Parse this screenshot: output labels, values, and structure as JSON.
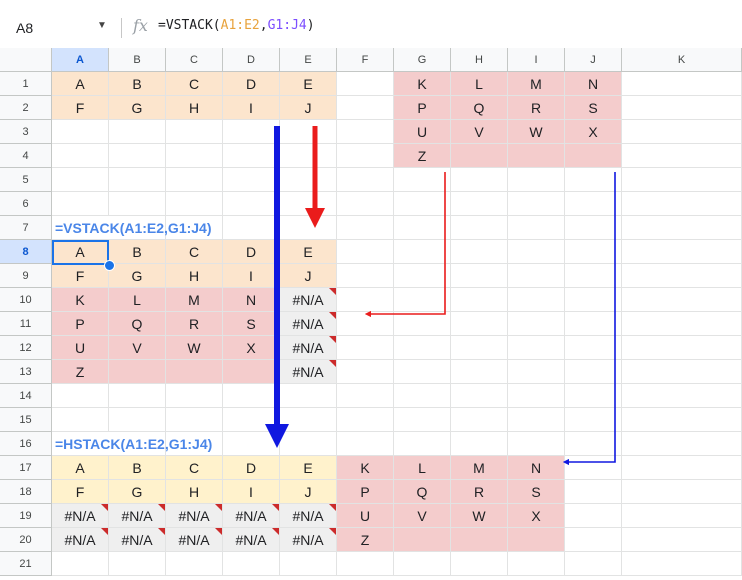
{
  "name_box": {
    "value": "A8"
  },
  "formula_bar": {
    "fx_label": "fx",
    "formula": "=VSTACK(A1:E2,G1:J4)"
  },
  "columns": [
    "A",
    "B",
    "C",
    "D",
    "E",
    "F",
    "G",
    "H",
    "I",
    "J",
    "K"
  ],
  "rows": [
    "1",
    "2",
    "3",
    "4",
    "5",
    "6",
    "7",
    "8",
    "9",
    "10",
    "11",
    "12",
    "13",
    "14",
    "15",
    "16",
    "17",
    "18",
    "19",
    "20",
    "21"
  ],
  "selected": {
    "col": "A",
    "row": "8"
  },
  "colors": {
    "orange": "#fce5cd",
    "red": "#f4cccc",
    "yellow": "#fff2cc",
    "gray": "#efefef",
    "heading": "#4a86e8",
    "arrow_red": "#ea1c1c",
    "arrow_blue": "#1018e0",
    "selection": "#1a73e8"
  },
  "cells": [
    {
      "ref": "A1",
      "value": "A",
      "fill": "orange"
    },
    {
      "ref": "B1",
      "value": "B",
      "fill": "orange"
    },
    {
      "ref": "C1",
      "value": "C",
      "fill": "orange"
    },
    {
      "ref": "D1",
      "value": "D",
      "fill": "orange"
    },
    {
      "ref": "E1",
      "value": "E",
      "fill": "orange"
    },
    {
      "ref": "A2",
      "value": "F",
      "fill": "orange"
    },
    {
      "ref": "B2",
      "value": "G",
      "fill": "orange"
    },
    {
      "ref": "C2",
      "value": "H",
      "fill": "orange"
    },
    {
      "ref": "D2",
      "value": "I",
      "fill": "orange"
    },
    {
      "ref": "E2",
      "value": "J",
      "fill": "orange"
    },
    {
      "ref": "G1",
      "value": "K",
      "fill": "red"
    },
    {
      "ref": "H1",
      "value": "L",
      "fill": "red"
    },
    {
      "ref": "I1",
      "value": "M",
      "fill": "red"
    },
    {
      "ref": "J1",
      "value": "N",
      "fill": "red"
    },
    {
      "ref": "G2",
      "value": "P",
      "fill": "red"
    },
    {
      "ref": "H2",
      "value": "Q",
      "fill": "red"
    },
    {
      "ref": "I2",
      "value": "R",
      "fill": "red"
    },
    {
      "ref": "J2",
      "value": "S",
      "fill": "red"
    },
    {
      "ref": "G3",
      "value": "U",
      "fill": "red"
    },
    {
      "ref": "H3",
      "value": "V",
      "fill": "red"
    },
    {
      "ref": "I3",
      "value": "W",
      "fill": "red"
    },
    {
      "ref": "J3",
      "value": "X",
      "fill": "red"
    },
    {
      "ref": "G4",
      "value": "Z",
      "fill": "red"
    },
    {
      "ref": "H4",
      "value": "",
      "fill": "red"
    },
    {
      "ref": "I4",
      "value": "",
      "fill": "red"
    },
    {
      "ref": "J4",
      "value": "",
      "fill": "red"
    },
    {
      "ref": "A7",
      "value": "=VSTACK(A1:E2,G1:J4)",
      "style": "heading"
    },
    {
      "ref": "A8",
      "value": "A",
      "fill": "orange"
    },
    {
      "ref": "B8",
      "value": "B",
      "fill": "orange"
    },
    {
      "ref": "C8",
      "value": "C",
      "fill": "orange"
    },
    {
      "ref": "D8",
      "value": "D",
      "fill": "orange"
    },
    {
      "ref": "E8",
      "value": "E",
      "fill": "orange"
    },
    {
      "ref": "A9",
      "value": "F",
      "fill": "orange"
    },
    {
      "ref": "B9",
      "value": "G",
      "fill": "orange"
    },
    {
      "ref": "C9",
      "value": "H",
      "fill": "orange"
    },
    {
      "ref": "D9",
      "value": "I",
      "fill": "orange"
    },
    {
      "ref": "E9",
      "value": "J",
      "fill": "orange"
    },
    {
      "ref": "A10",
      "value": "K",
      "fill": "red"
    },
    {
      "ref": "B10",
      "value": "L",
      "fill": "red"
    },
    {
      "ref": "C10",
      "value": "M",
      "fill": "red"
    },
    {
      "ref": "D10",
      "value": "N",
      "fill": "red"
    },
    {
      "ref": "E10",
      "value": "#N/A",
      "fill": "gray",
      "error": true
    },
    {
      "ref": "A11",
      "value": "P",
      "fill": "red"
    },
    {
      "ref": "B11",
      "value": "Q",
      "fill": "red"
    },
    {
      "ref": "C11",
      "value": "R",
      "fill": "red"
    },
    {
      "ref": "D11",
      "value": "S",
      "fill": "red"
    },
    {
      "ref": "E11",
      "value": "#N/A",
      "fill": "gray",
      "error": true
    },
    {
      "ref": "A12",
      "value": "U",
      "fill": "red"
    },
    {
      "ref": "B12",
      "value": "V",
      "fill": "red"
    },
    {
      "ref": "C12",
      "value": "W",
      "fill": "red"
    },
    {
      "ref": "D12",
      "value": "X",
      "fill": "red"
    },
    {
      "ref": "E12",
      "value": "#N/A",
      "fill": "gray",
      "error": true
    },
    {
      "ref": "A13",
      "value": "Z",
      "fill": "red"
    },
    {
      "ref": "B13",
      "value": "",
      "fill": "red"
    },
    {
      "ref": "C13",
      "value": "",
      "fill": "red"
    },
    {
      "ref": "D13",
      "value": "",
      "fill": "red"
    },
    {
      "ref": "E13",
      "value": "#N/A",
      "fill": "gray",
      "error": true
    },
    {
      "ref": "A16",
      "value": "=HSTACK(A1:E2,G1:J4)",
      "style": "heading"
    },
    {
      "ref": "A17",
      "value": "A",
      "fill": "yellow"
    },
    {
      "ref": "B17",
      "value": "B",
      "fill": "yellow"
    },
    {
      "ref": "C17",
      "value": "C",
      "fill": "yellow"
    },
    {
      "ref": "D17",
      "value": "D",
      "fill": "yellow"
    },
    {
      "ref": "E17",
      "value": "E",
      "fill": "yellow"
    },
    {
      "ref": "F17",
      "value": "K",
      "fill": "red"
    },
    {
      "ref": "G17",
      "value": "L",
      "fill": "red"
    },
    {
      "ref": "H17",
      "value": "M",
      "fill": "red"
    },
    {
      "ref": "I17",
      "value": "N",
      "fill": "red"
    },
    {
      "ref": "A18",
      "value": "F",
      "fill": "yellow"
    },
    {
      "ref": "B18",
      "value": "G",
      "fill": "yellow"
    },
    {
      "ref": "C18",
      "value": "H",
      "fill": "yellow"
    },
    {
      "ref": "D18",
      "value": "I",
      "fill": "yellow"
    },
    {
      "ref": "E18",
      "value": "J",
      "fill": "yellow"
    },
    {
      "ref": "F18",
      "value": "P",
      "fill": "red"
    },
    {
      "ref": "G18",
      "value": "Q",
      "fill": "red"
    },
    {
      "ref": "H18",
      "value": "R",
      "fill": "red"
    },
    {
      "ref": "I18",
      "value": "S",
      "fill": "red"
    },
    {
      "ref": "A19",
      "value": "#N/A",
      "fill": "gray",
      "error": true
    },
    {
      "ref": "B19",
      "value": "#N/A",
      "fill": "gray",
      "error": true
    },
    {
      "ref": "C19",
      "value": "#N/A",
      "fill": "gray",
      "error": true
    },
    {
      "ref": "D19",
      "value": "#N/A",
      "fill": "gray",
      "error": true
    },
    {
      "ref": "E19",
      "value": "#N/A",
      "fill": "gray",
      "error": true
    },
    {
      "ref": "F19",
      "value": "U",
      "fill": "red"
    },
    {
      "ref": "G19",
      "value": "V",
      "fill": "red"
    },
    {
      "ref": "H19",
      "value": "W",
      "fill": "red"
    },
    {
      "ref": "I19",
      "value": "X",
      "fill": "red"
    },
    {
      "ref": "A20",
      "value": "#N/A",
      "fill": "gray",
      "error": true
    },
    {
      "ref": "B20",
      "value": "#N/A",
      "fill": "gray",
      "error": true
    },
    {
      "ref": "C20",
      "value": "#N/A",
      "fill": "gray",
      "error": true
    },
    {
      "ref": "D20",
      "value": "#N/A",
      "fill": "gray",
      "error": true
    },
    {
      "ref": "E20",
      "value": "#N/A",
      "fill": "gray",
      "error": true
    },
    {
      "ref": "F20",
      "value": "Z",
      "fill": "red"
    },
    {
      "ref": "G20",
      "value": "",
      "fill": "red"
    },
    {
      "ref": "H20",
      "value": "",
      "fill": "red"
    },
    {
      "ref": "I20",
      "value": "",
      "fill": "red"
    }
  ]
}
